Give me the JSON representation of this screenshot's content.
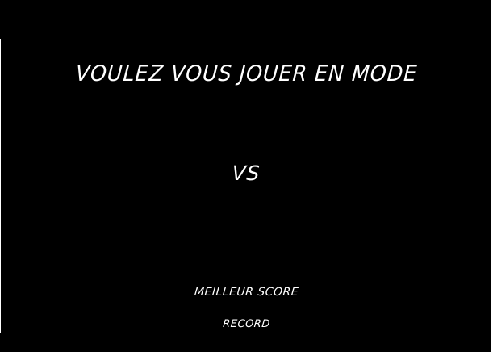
{
  "menu": {
    "question": "VOULEZ VOUS JOUER EN MODE",
    "mode_option": "VS"
  },
  "score": {
    "label": "MEILLEUR SCORE",
    "value": "RECORD"
  },
  "colors": {
    "background": "#000000",
    "text": "#ffffff"
  }
}
